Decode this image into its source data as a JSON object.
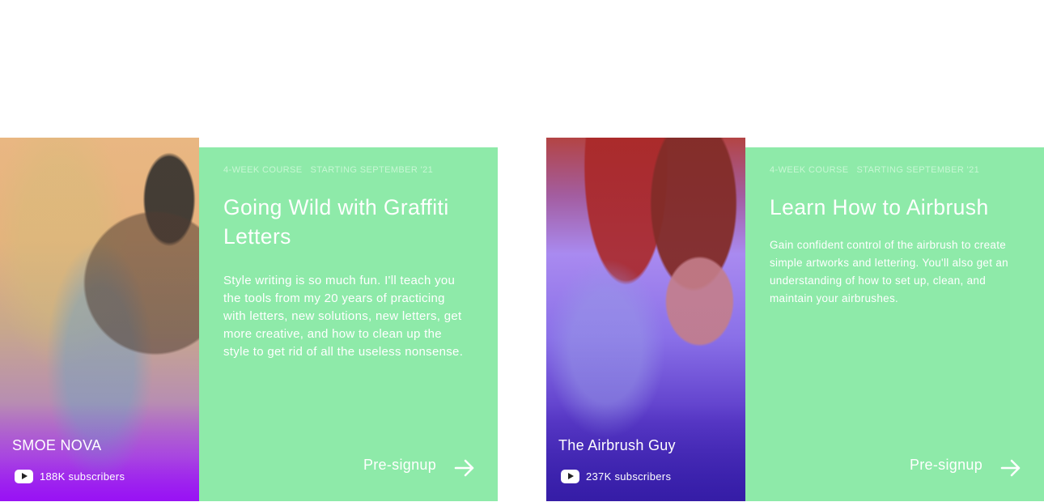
{
  "cards": [
    {
      "creator": "SMOE NOVA",
      "subscribers": "188K subscribers",
      "meta_duration": "4-WEEK COURSE",
      "meta_start": "STARTING SEPTEMBER '21",
      "title": "Going Wild with Graffiti Letters",
      "description": "Style writing is so much fun. I'll teach you the tools from my 20 years of practicing with letters, new solutions, new letters, get more creative, and how to clean up the style to get rid of all the useless nonsense.",
      "cta": "Pre-signup"
    },
    {
      "creator": "The Airbrush Guy",
      "subscribers": "237K subscribers",
      "meta_duration": "4-WEEK COURSE",
      "meta_start": "STARTING SEPTEMBER '21",
      "title": "Learn How to Airbrush",
      "description": "Gain confident control of the airbrush to create simple artworks and lettering. You'll also get an understanding of how to set up, clean, and maintain your airbrushes.",
      "cta": "Pre-signup"
    }
  ],
  "icons": {
    "platform": "youtube-icon",
    "cta": "arrow-right-icon"
  },
  "colors": {
    "panel": "#8eeaa9",
    "text": "#ffffff",
    "gradient_purple": "#9b0ff5"
  }
}
